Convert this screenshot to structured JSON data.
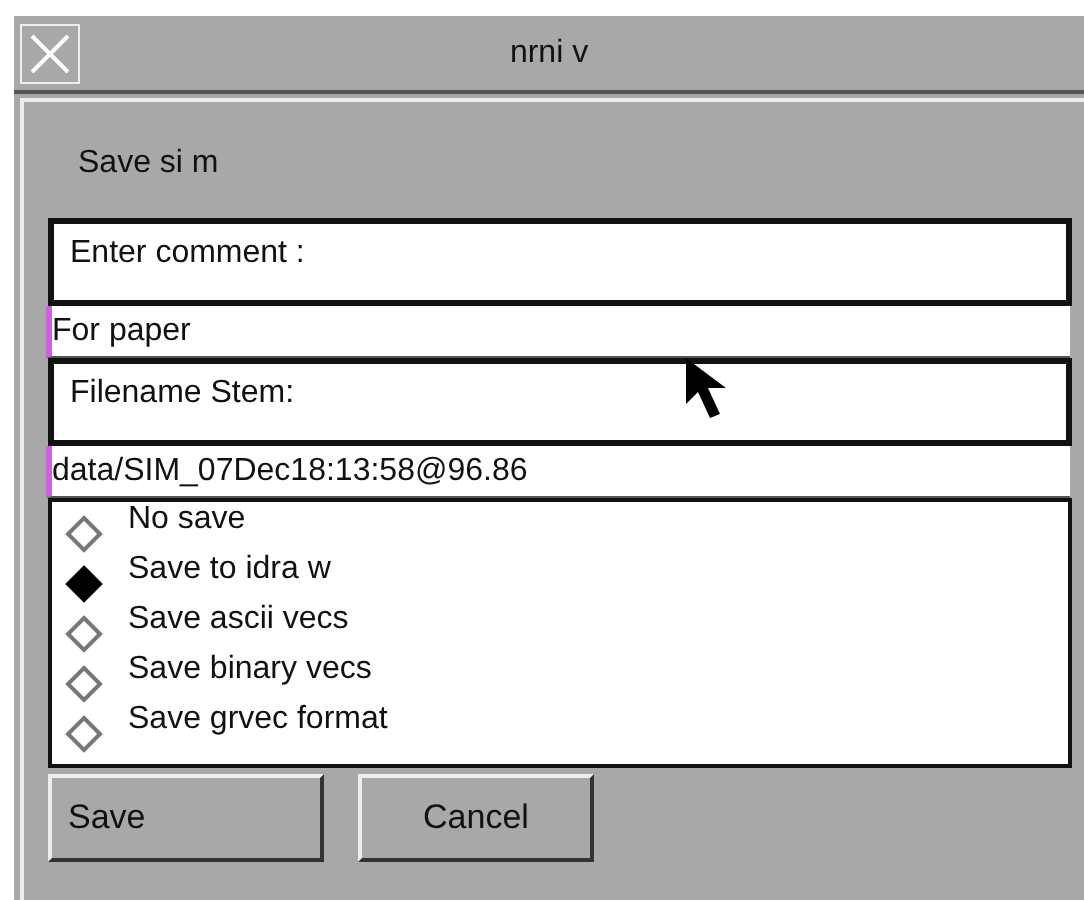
{
  "window": {
    "title": "nrni v"
  },
  "dialog": {
    "heading": "Save si m",
    "comment": {
      "label": "Enter comment  :",
      "value": "For paper"
    },
    "filename": {
      "label": "Filename Stem:",
      "value": "data/SIM_07Dec18:13:58@96.86"
    },
    "options": [
      {
        "label": "No save",
        "selected": false
      },
      {
        "label": "Save to idra w",
        "selected": true
      },
      {
        "label": "Save ascii vecs",
        "selected": false
      },
      {
        "label": "Save binary vecs",
        "selected": false
      },
      {
        "label": "Save grvec format",
        "selected": false
      }
    ],
    "buttons": [
      "Save",
      "Cancel"
    ]
  }
}
